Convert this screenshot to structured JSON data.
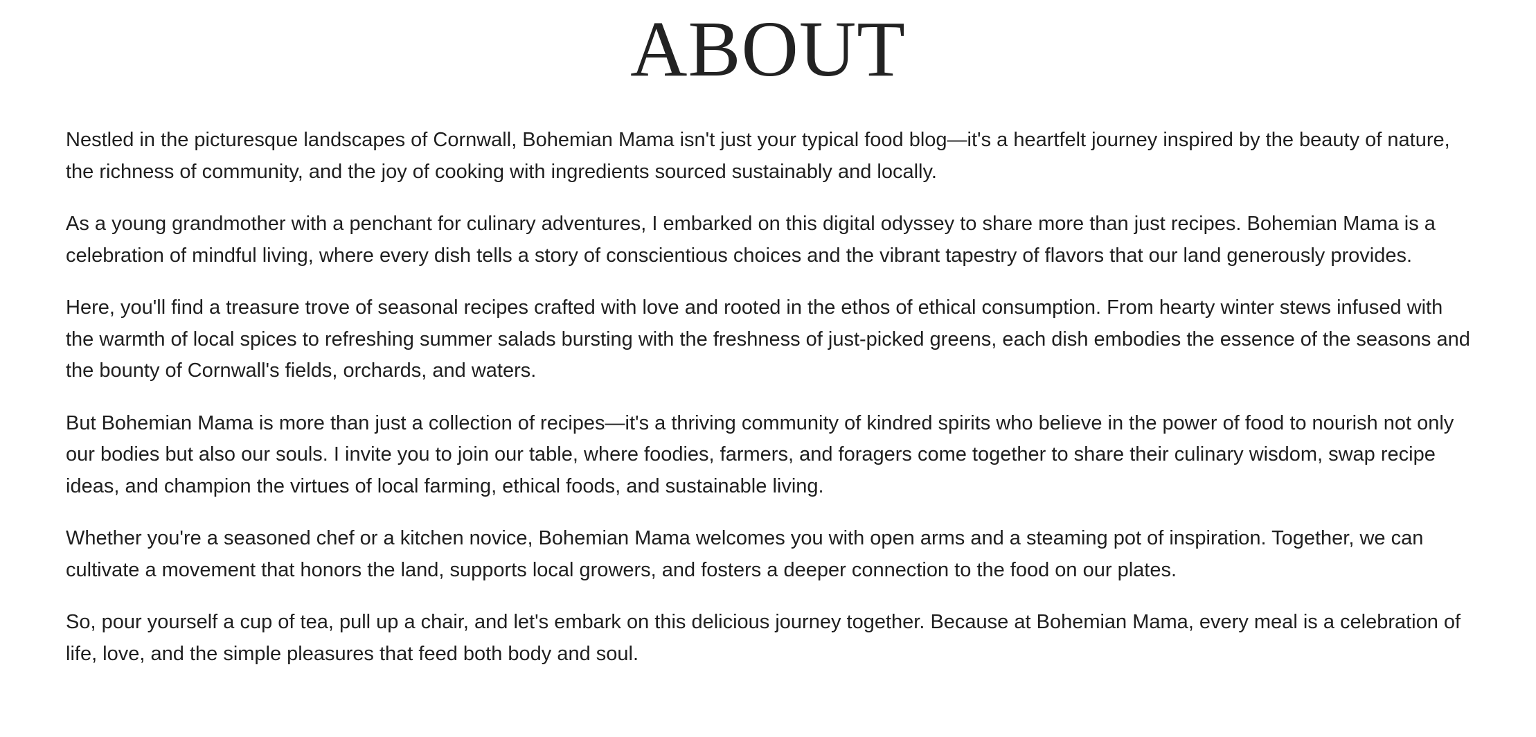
{
  "page": {
    "title": "ABOUT"
  },
  "paragraphs": [
    "Nestled in the picturesque landscapes of Cornwall, Bohemian Mama isn't just your typical food blog—it's a heartfelt journey inspired by the beauty of nature, the richness of community, and the joy of cooking with ingredients sourced sustainably and locally.",
    "As a young grandmother with a penchant for culinary adventures, I embarked on this digital odyssey to share more than just recipes. Bohemian Mama is a celebration of mindful living, where every dish tells a story of conscientious choices and the vibrant tapestry of flavors that our land generously provides.",
    "Here, you'll find a treasure trove of seasonal recipes crafted with love and rooted in the ethos of ethical consumption. From hearty winter stews infused with the warmth of local spices to refreshing summer salads bursting with the freshness of just-picked greens, each dish embodies the essence of the seasons and the bounty of Cornwall's fields, orchards, and waters.",
    "But Bohemian Mama is more than just a collection of recipes—it's a thriving community of kindred spirits who believe in the power of food to nourish not only our bodies but also our souls. I invite you to join our table, where foodies, farmers, and foragers come together to share their culinary wisdom, swap recipe ideas, and champion the virtues of local farming, ethical foods, and sustainable living.",
    "Whether you're a seasoned chef or a kitchen novice, Bohemian Mama welcomes you with open arms and a steaming pot of inspiration. Together, we can cultivate a movement that honors the land, supports local growers, and fosters a deeper connection to the food on our plates.",
    "So, pour yourself a cup of tea, pull up a chair, and let's embark on this delicious journey together. Because at Bohemian Mama, every meal is a celebration of life, love, and the simple pleasures that feed both body and soul."
  ],
  "colors": {
    "background": "#ffffff",
    "text": "#1f1f1f",
    "heading": "#222222"
  }
}
